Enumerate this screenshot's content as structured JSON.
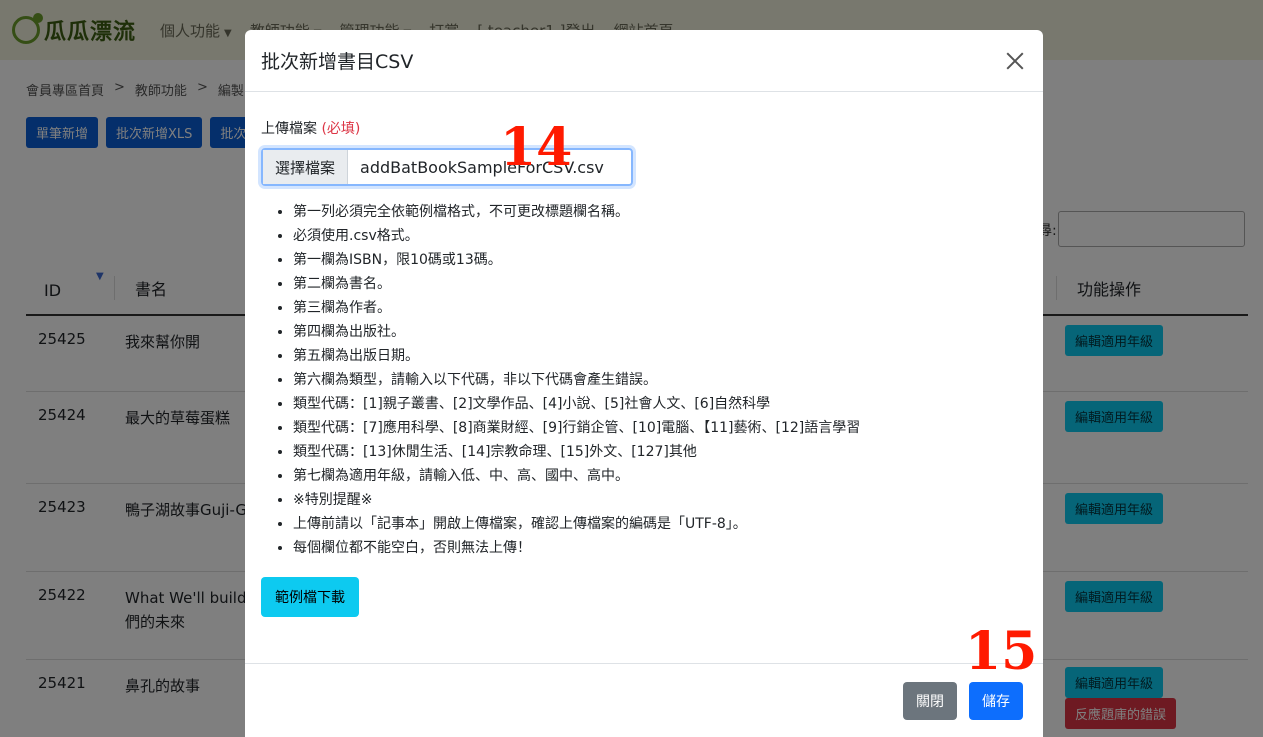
{
  "navbar": {
    "brand": "瓜瓜漂流",
    "items": [
      "個人功能",
      "教師功能",
      "管理功能",
      "打賞",
      "[ teacher1 ]登出",
      "網站首頁"
    ]
  },
  "breadcrumb": [
    "會員專區首頁",
    ">",
    "教師功能",
    ">",
    "編製"
  ],
  "actions": [
    "單筆新增",
    "批次新增XLS",
    "批次"
  ],
  "search_label": "尋:",
  "table": {
    "headers": {
      "id": "ID",
      "name": "書名",
      "func": "功能操作"
    },
    "rows": [
      {
        "id": "25425",
        "name": "我來幫你開",
        "edit": "編輯適用年級"
      },
      {
        "id": "25424",
        "name": "最大的草莓蛋糕",
        "edit": "編輯適用年級"
      },
      {
        "id": "25423",
        "name": "鴨子湖故事Guji-G",
        "edit": "編輯適用年級"
      },
      {
        "id": "25422",
        "name": "What We'll build 們的未來",
        "edit": "編輯適用年級"
      },
      {
        "id": "25421",
        "name": "鼻孔的故事",
        "edit": "編輯適用年級",
        "report": "反應題庫的錯誤"
      }
    ]
  },
  "modal": {
    "title": "批次新增書目CSV",
    "upload_label": "上傳檔案",
    "required": "(必填)",
    "choose_file": "選擇檔案",
    "file_name": "addBatBookSampleForCSV.csv",
    "rules": [
      "第一列必須完全依範例檔格式，不可更改標題欄名稱。",
      "必須使用.csv格式。",
      "第一欄為ISBN，限10碼或13碼。",
      "第二欄為書名。",
      "第三欄為作者。",
      "第四欄為出版社。",
      "第五欄為出版日期。",
      "第六欄為類型，請輸入以下代碼，非以下代碼會產生錯誤。",
      "類型代碼：[1]親子叢書、[2]文學作品、[4]小說、[5]社會人文、[6]自然科學",
      "類型代碼：[7]應用科學、[8]商業財經、[9]行銷企管、[10]電腦、【11]藝術、[12]語言學習",
      "類型代碼：[13]休閒生活、[14]宗教命理、[15]外文、[127]其他",
      "第七欄為適用年級，請輸入低、中、高、國中、高中。",
      "※特別提醒※",
      "上傳前請以「記事本」開啟上傳檔案，確認上傳檔案的編碼是「UTF-8」。",
      "每個欄位都不能空白，否則無法上傳！"
    ],
    "sample_download": "範例檔下載",
    "close_label": "關閉",
    "save_label": "儲存"
  },
  "annotations": {
    "file": "14",
    "save": "15"
  },
  "colors": {
    "annotation": "#ff1a00",
    "primary": "#0d6efd",
    "info": "#0dcaf0",
    "secondary": "#6c757d",
    "danger": "#dc3545"
  }
}
